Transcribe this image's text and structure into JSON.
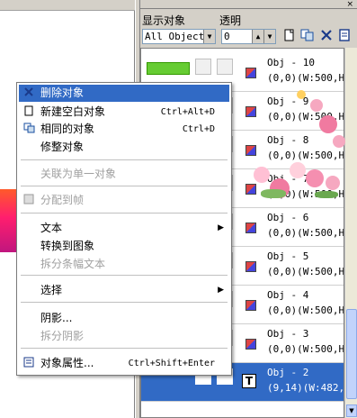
{
  "panel": {
    "display_label": "显示对象",
    "opacity_label": "透明",
    "display_select_value": "All Object",
    "opacity_value": "0",
    "close_glyph": "×",
    "toolbar_icons": [
      "new-object-icon",
      "copy-object-icon",
      "delete-object-icon",
      "document-icon"
    ]
  },
  "objects": [
    {
      "name": "Obj - 10",
      "pos": "(0,0)(W:500,H:",
      "thumb": "wide"
    },
    {
      "name": "Obj - 9",
      "pos": "(0,0)(W:500,H:",
      "thumb": "plain"
    },
    {
      "name": "Obj - 8",
      "pos": "(0,0)(W:500,H:",
      "thumb": "plain"
    },
    {
      "name": "Obj - 7",
      "pos": "(0,0)(W:500,H:",
      "thumb": "plain"
    },
    {
      "name": "Obj - 6",
      "pos": "(0,0)(W:500,H:",
      "thumb": "plain"
    },
    {
      "name": "Obj - 5",
      "pos": "(0,0)(W:500,H:",
      "thumb": "plain"
    },
    {
      "name": "Obj - 4",
      "pos": "(0,0)(W:500,H:",
      "thumb": "plain"
    },
    {
      "name": "Obj - 3",
      "pos": "(0,0)(W:500,H:",
      "thumb": "plain"
    },
    {
      "name": "Obj - 2",
      "pos": "(9,14)(W:482,H:",
      "thumb": "text",
      "selected": true
    }
  ],
  "menu": {
    "items": [
      {
        "label": "删除对象",
        "icon": "delete-object-icon",
        "highlighted": true
      },
      {
        "label": "新建空白对象",
        "icon": "new-blank-object-icon",
        "shortcut": "Ctrl+Alt+D"
      },
      {
        "label": "相同的对象",
        "icon": "duplicate-object-icon",
        "shortcut": "Ctrl+D"
      },
      {
        "label": "修整对象"
      },
      {
        "label": "关联为单一对象",
        "disabled": true
      },
      {
        "label": "分配到帧",
        "icon": "frame-icon",
        "disabled": true
      },
      {
        "label": "文本",
        "submenu": true
      },
      {
        "label": "转换到图象"
      },
      {
        "label": "拆分条幅文本",
        "disabled": true
      },
      {
        "label": "选择",
        "submenu": true
      },
      {
        "label": "阴影..."
      },
      {
        "label": "拆分阴影",
        "disabled": true
      },
      {
        "label": "对象属性...",
        "icon": "properties-icon",
        "shortcut": "Ctrl+Shift+Enter"
      }
    ],
    "submenu_arrow": "▶"
  },
  "colors": {
    "highlight": "#316ac5",
    "panel_bg": "#d4d0c8",
    "disabled_text": "#a0a0a0"
  }
}
